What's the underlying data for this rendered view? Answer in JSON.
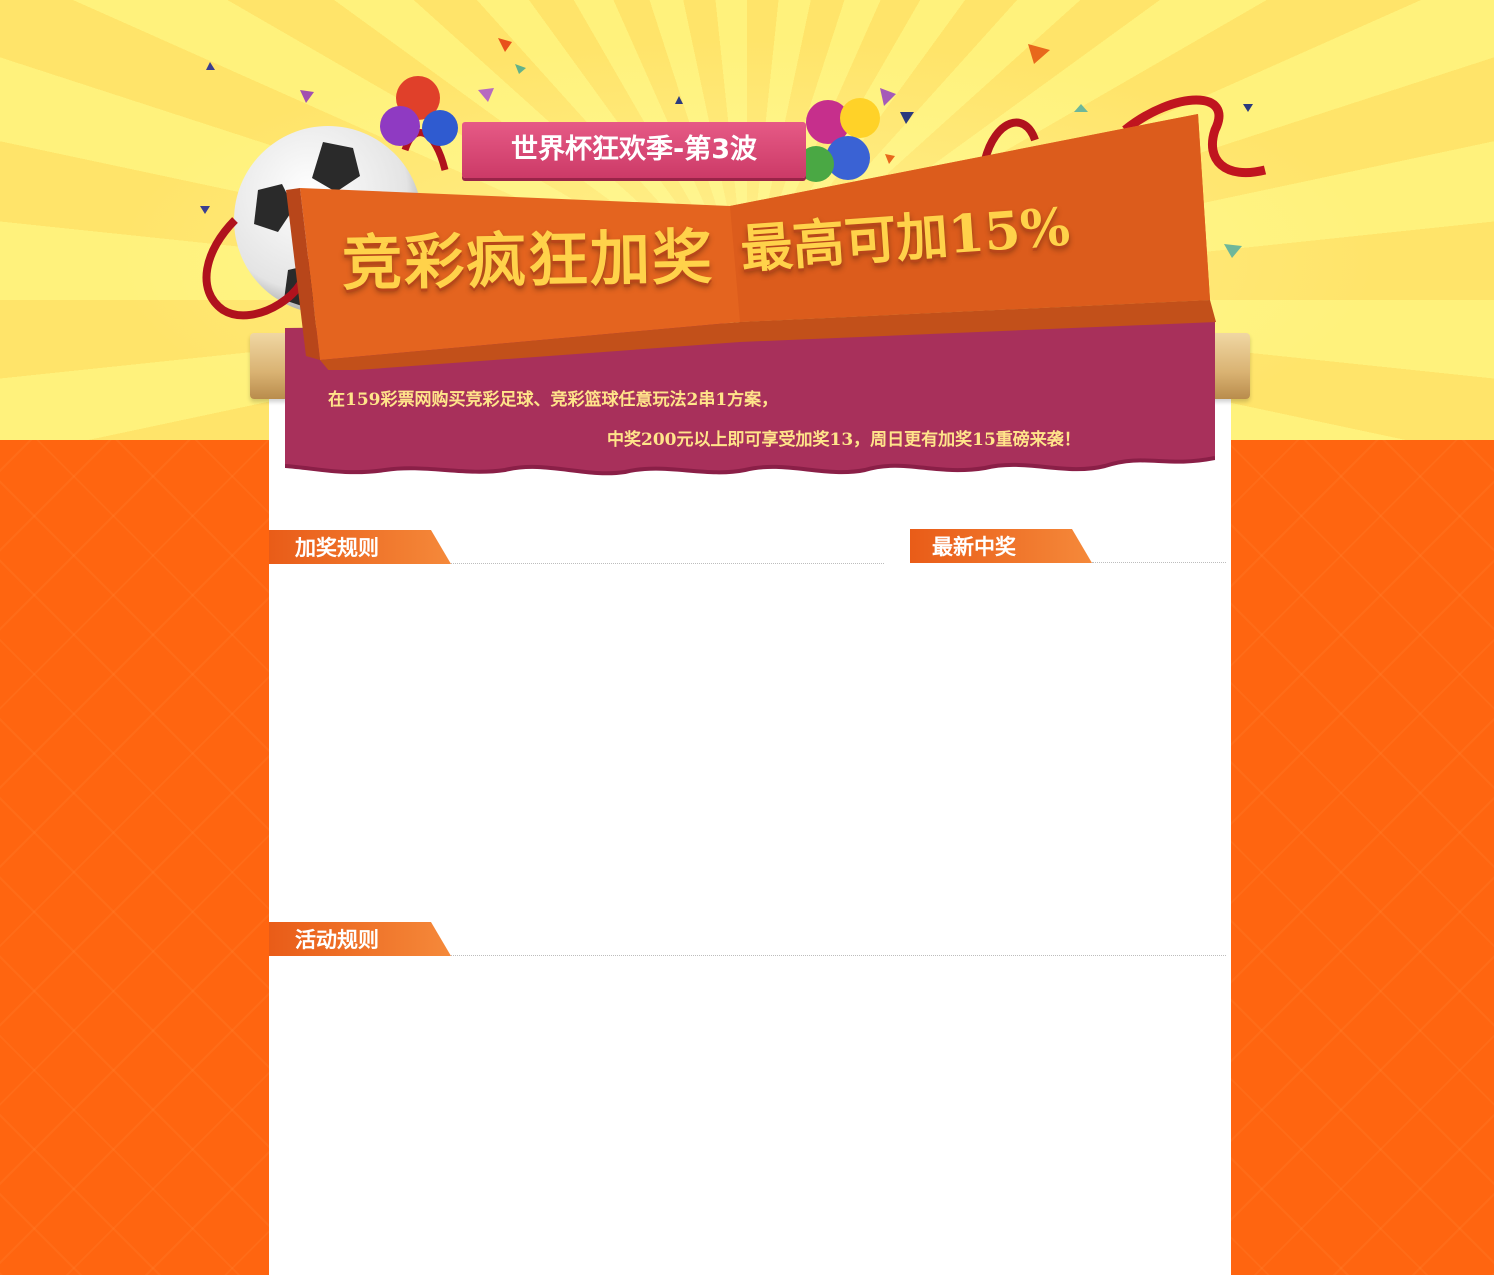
{
  "banner": {
    "tag": "世界杯狂欢季-第3波",
    "title_main": "竞彩疯狂加奖",
    "title_max": "最高可加15%",
    "description_line1": "在159彩票网购买竞彩足球、竞彩篮球任意玩法2串1方案，",
    "description_line2": "中奖200元以上即可享受加奖13，周日更有加奖15重磅来袭！"
  },
  "sections": {
    "bonus_rules": "加奖规则",
    "latest_winners": "最新中奖",
    "activity_rules": "活动规则"
  },
  "colors": {
    "sunburst_light": "#fff27c",
    "sunburst_dark": "#ffe46a",
    "page_orange": "#ff6510",
    "ribbon_orange": "#e4641f",
    "cloth_purple": "#a8305b",
    "tag_pink": "#e0507d",
    "title_gold": "#ffd24a"
  },
  "decorations": [
    "soccer-ball-icon",
    "balloons-icon",
    "red-ribbon-icon",
    "confetti-icon"
  ]
}
